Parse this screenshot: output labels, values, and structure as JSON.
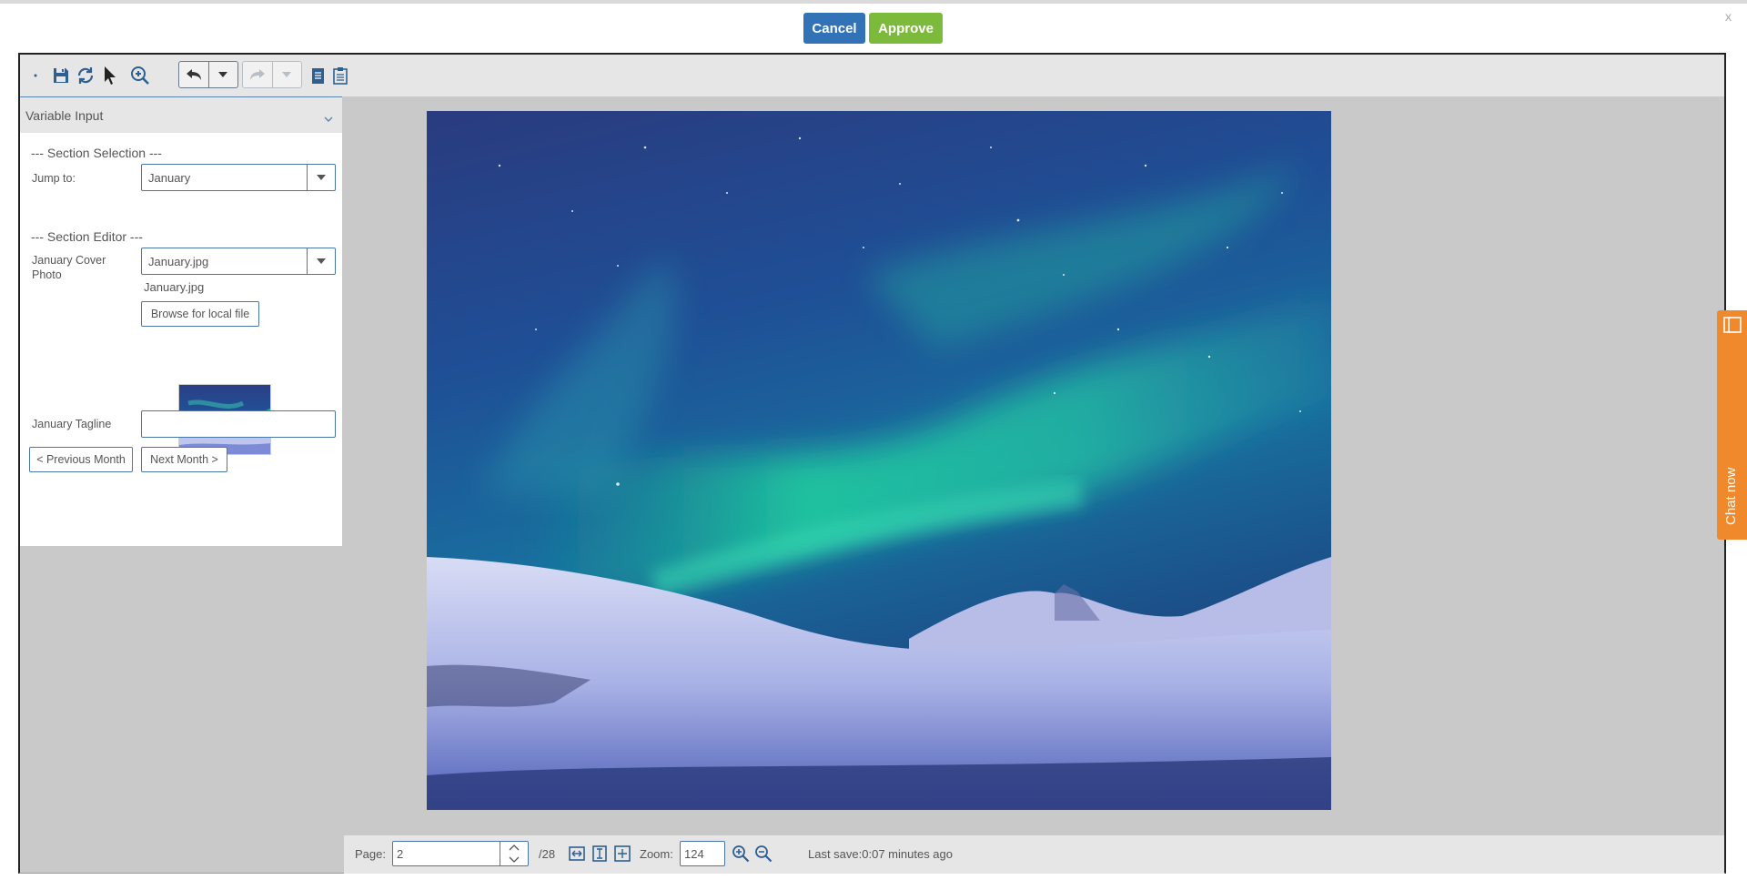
{
  "header": {
    "cancel_label": "Cancel",
    "approve_label": "Approve",
    "close_label": "x"
  },
  "toolbar": {
    "icons": [
      "save-icon",
      "refresh-icon",
      "pointer-icon",
      "zoom-in-icon",
      "undo-icon",
      "dropdown-icon",
      "redo-icon",
      "dropdown-icon",
      "page-icon",
      "clipboard-icon"
    ]
  },
  "panel": {
    "title": "Variable Input",
    "section_selection_title": "--- Section Selection ---",
    "jump_label": "Jump to:",
    "jump_value": "January",
    "section_editor_title": "--- Section Editor ---",
    "cover_photo_label": "January Cover Photo",
    "cover_photo_value": "January.jpg",
    "cover_photo_filename": "January.jpg",
    "browse_label": "Browse for local file",
    "tagline_label": "January Tagline",
    "tagline_value": "",
    "prev_label": "< Previous Month",
    "next_label": "Next Month >"
  },
  "status": {
    "page_label": "Page:",
    "page_value": "2",
    "page_total": "/28",
    "zoom_label": "Zoom:",
    "zoom_value": "124",
    "last_save": "Last save:0:07 minutes ago"
  },
  "chat": {
    "label": "Chat now"
  },
  "colors": {
    "cancel": "#3273b7",
    "approve": "#7cba3c",
    "chat": "#f0892b",
    "border_blue": "#4a76a8"
  }
}
